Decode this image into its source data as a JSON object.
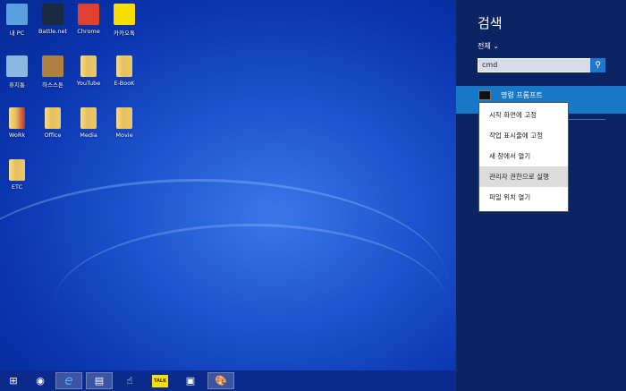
{
  "desktop": {
    "icons": [
      {
        "label": "내 PC",
        "icon": "computer-icon",
        "color": "#5aa0e0"
      },
      {
        "label": "Battle.net",
        "icon": "battlenet-icon",
        "color": "#1a2a40"
      },
      {
        "label": "Chrome",
        "icon": "chrome-icon",
        "color": "#e04030"
      },
      {
        "label": "카카오톡",
        "icon": "kakaotalk-icon",
        "color": "#f7e000"
      },
      {
        "label": "휴지통",
        "icon": "recycle-bin-icon",
        "color": "#8ab8e0"
      },
      {
        "label": "하스스톤",
        "icon": "hearthstone-icon",
        "color": "#b08040"
      },
      {
        "label": "YouTube",
        "icon": "folder-icon",
        "color": "#e8c868"
      },
      {
        "label": "E-BooK",
        "icon": "folder-icon",
        "color": "#e8c868"
      },
      {
        "label": "WoRk",
        "icon": "folder-icon",
        "color": "#c03030"
      },
      {
        "label": "Office",
        "icon": "folder-icon",
        "color": "#e8c868"
      },
      {
        "label": "Media",
        "icon": "folder-icon",
        "color": "#e8c868"
      },
      {
        "label": "Movie",
        "icon": "folder-icon",
        "color": "#e8c868"
      },
      {
        "label": "ETC",
        "icon": "folder-icon",
        "color": "#e8c868"
      }
    ]
  },
  "taskbar": {
    "items": [
      {
        "icon": "windows-start-icon",
        "glyph": "⊞"
      },
      {
        "icon": "media-player-icon",
        "glyph": "◉"
      },
      {
        "icon": "internet-explorer-icon",
        "glyph": "e"
      },
      {
        "icon": "file-explorer-icon",
        "glyph": "▤"
      },
      {
        "icon": "hand-cursor-icon",
        "glyph": "☝"
      },
      {
        "icon": "kakaotalk-icon",
        "glyph": "TALK"
      },
      {
        "icon": "remote-desktop-icon",
        "glyph": "▣"
      },
      {
        "icon": "paint-icon",
        "glyph": "🎨"
      }
    ]
  },
  "charm": {
    "title": "검색",
    "scope": "전체",
    "search_value": "cmd",
    "result": "명령 프롬프트"
  },
  "context_menu": {
    "items": [
      "시작 화면에 고정",
      "작업 표시줄에 고정",
      "새 창에서 열기",
      "관리자 권한으로 실행",
      "파일 위치 열기"
    ]
  }
}
